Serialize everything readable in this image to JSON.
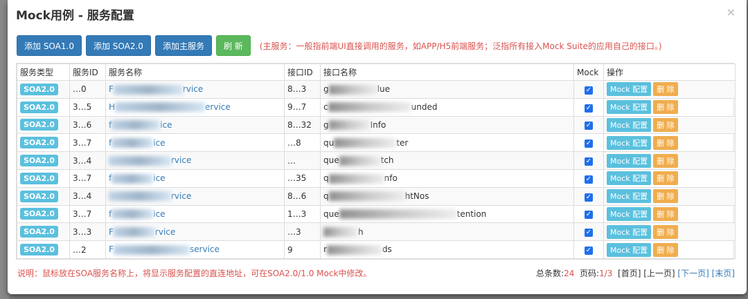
{
  "modal": {
    "title": "Mock用例 - 服务配置",
    "close_symbol": "×"
  },
  "toolbar": {
    "buttons": [
      "添加 SOA1.0",
      "添加 SOA2.0",
      "添加主服务",
      "刷 新"
    ],
    "hint": "(主服务：一般指前端UI直接调用的服务，如APP/H5前端服务；泛指所有接入Mock Suite的应用自己的接口。)"
  },
  "table": {
    "headers": [
      "服务类型",
      "服务ID",
      "服务名称",
      "接口ID",
      "接口名称",
      "Mock",
      "操作"
    ],
    "rows": [
      {
        "type": "SOA2.0",
        "sid": "…0",
        "sname_prefix": "F",
        "sname_suffix": "rvice",
        "iid": "8…3",
        "iname_prefix": "g",
        "iname_suffix": "lue",
        "mock": "✓"
      },
      {
        "type": "SOA2.0",
        "sid": "3…5",
        "sname_prefix": "H",
        "sname_suffix": "ervice",
        "iid": "9…7",
        "iname_prefix": "c",
        "iname_suffix": "unded",
        "mock": "✓"
      },
      {
        "type": "SOA2.0",
        "sid": "3…6",
        "sname_prefix": "f",
        "sname_suffix": "ice",
        "iid": "8…32",
        "iname_prefix": "g",
        "iname_suffix": "Info",
        "mock": "✓"
      },
      {
        "type": "SOA2.0",
        "sid": "3…7",
        "sname_prefix": "f",
        "sname_suffix": "ice",
        "iid": "…8",
        "iname_prefix": "qu",
        "iname_suffix": "ter",
        "mock": "✓"
      },
      {
        "type": "SOA2.0",
        "sid": "3…4",
        "sname_prefix": "",
        "sname_suffix": "rvice",
        "iid": "…",
        "iname_prefix": "que",
        "iname_suffix": "tch",
        "mock": "✓"
      },
      {
        "type": "SOA2.0",
        "sid": "3…7",
        "sname_prefix": "f",
        "sname_suffix": "ice",
        "iid": "…35",
        "iname_prefix": "q",
        "iname_suffix": "nfo",
        "mock": "✓"
      },
      {
        "type": "SOA2.0",
        "sid": "3…4",
        "sname_prefix": "",
        "sname_suffix": "rvice",
        "iid": "8…6",
        "iname_prefix": "q",
        "iname_suffix": "htNos",
        "mock": "✓"
      },
      {
        "type": "SOA2.0",
        "sid": "3…7",
        "sname_prefix": "f",
        "sname_suffix": "ice",
        "iid": "1…3",
        "iname_prefix": "que",
        "iname_suffix": "tention",
        "mock": "✓"
      },
      {
        "type": "SOA2.0",
        "sid": "3…3",
        "sname_prefix": "F",
        "sname_suffix": "rvice",
        "iid": "…3",
        "iname_prefix": "",
        "iname_suffix": "h",
        "mock": "✓"
      },
      {
        "type": "SOA2.0",
        "sid": "…2",
        "sname_prefix": "F",
        "sname_suffix": "service",
        "iid": "9",
        "iname_prefix": "r",
        "iname_suffix": "ds",
        "mock": "✓"
      }
    ],
    "action_labels": {
      "mock": "Mock 配置",
      "delete": "删 除"
    }
  },
  "footer": {
    "note": "说明：鼠标放在SOA服务名称上，将显示服务配置的直连地址，可在SOA2.0/1.0 Mock中修改。",
    "total_label": "总条数:",
    "total_value": "24",
    "page_label": "页码:",
    "page_value": "1/3",
    "first": "[首页]",
    "prev": "[上一页]",
    "next": "[下一页]",
    "last": "[末页]"
  },
  "colors": {
    "primary": "#337ab7",
    "success": "#5cb85c",
    "info": "#5bc0de",
    "warning": "#f0ad4e",
    "danger": "#d9534f"
  }
}
